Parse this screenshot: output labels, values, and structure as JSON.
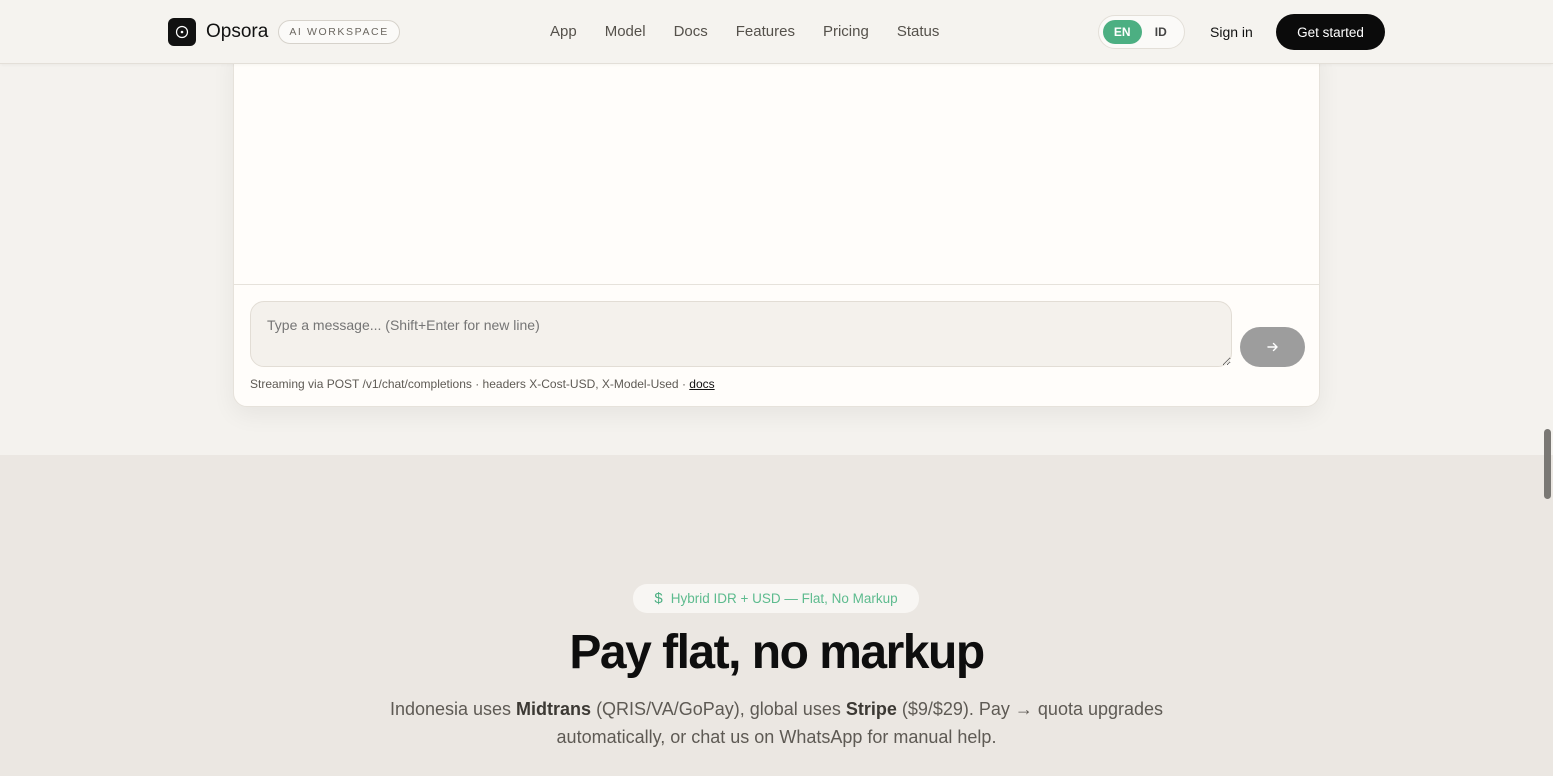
{
  "header": {
    "brand": "Opsora",
    "tag": "AI WORKSPACE",
    "nav": [
      "App",
      "Model",
      "Docs",
      "Features",
      "Pricing",
      "Status"
    ],
    "lang": {
      "en": "EN",
      "id": "ID",
      "active": "EN"
    },
    "signin": "Sign in",
    "cta": "Get started"
  },
  "chat": {
    "placeholder": "Type a message... (Shift+Enter for new line)",
    "footer_text": "Streaming via POST /v1/chat/completions · headers X-Cost-USD, X-Model-Used · ",
    "footer_link": "docs"
  },
  "pricing": {
    "badge": "Hybrid IDR + USD — Flat, No Markup",
    "title": "Pay flat, no markup",
    "sub_1": "Indonesia uses ",
    "sub_brand_1": "Midtrans",
    "sub_2": " (QRIS/VA/GoPay), global uses ",
    "sub_brand_2": "Stripe",
    "sub_3": " ($9/$29). Pay → quota upgrades automatically, or chat us on WhatsApp for manual help."
  },
  "colors": {
    "accent_green": "#4caf82",
    "cta_black": "#0b0b0b",
    "send_gray": "#9d9d9d"
  }
}
